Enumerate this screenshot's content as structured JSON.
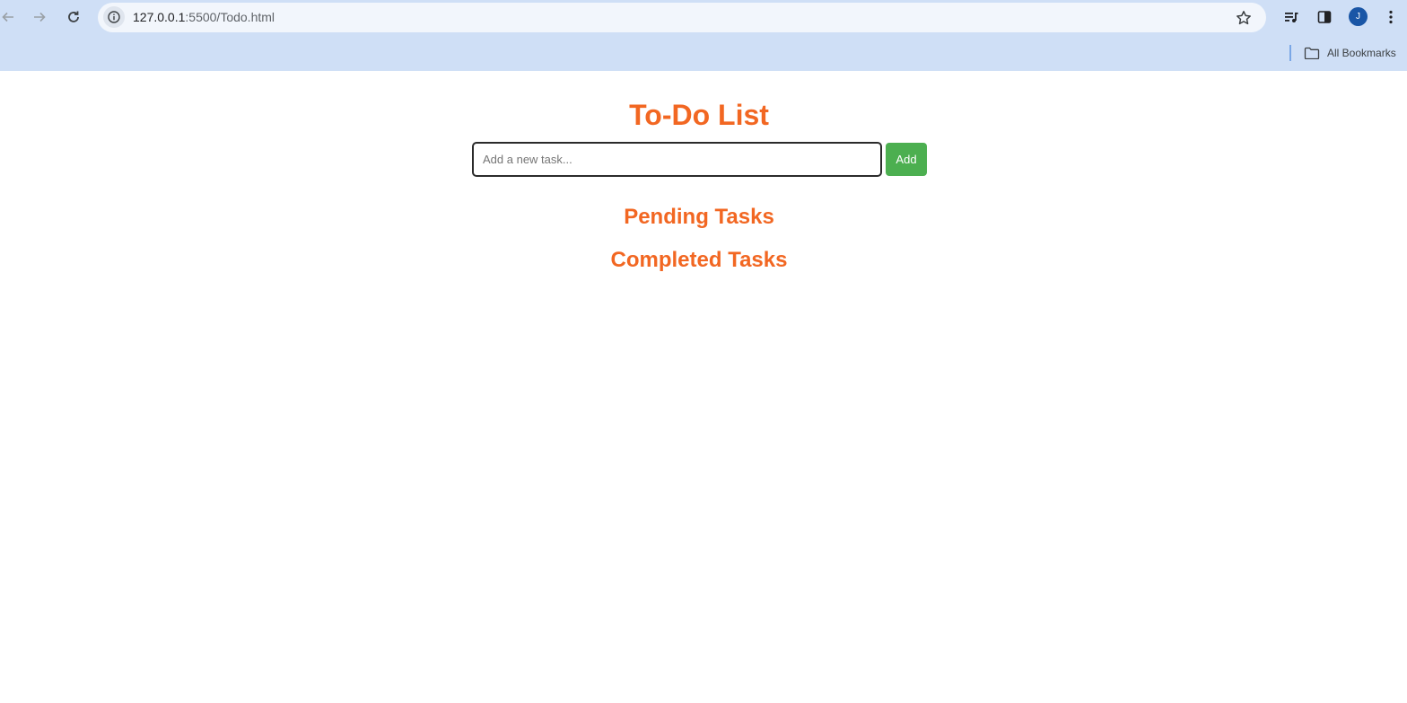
{
  "browser": {
    "url_host": "127.0.0.1",
    "url_path": ":5500/Todo.html",
    "avatar_letter": "J",
    "bookmarks_label": "All Bookmarks",
    "icons": {
      "back": "arrow-left",
      "forward": "arrow-right",
      "reload": "reload",
      "site_info": "info",
      "bookmark_star": "star",
      "media_controls": "queue-music",
      "side_panel": "side-panel",
      "menu": "vertical-dots",
      "bookmarks_folder": "folder"
    }
  },
  "app": {
    "title": "To-Do List",
    "input_placeholder": "Add a new task...",
    "add_label": "Add",
    "pending_heading": "Pending Tasks",
    "completed_heading": "Completed Tasks",
    "colors": {
      "heading": "#f26722",
      "add_button": "#4caf50"
    }
  }
}
